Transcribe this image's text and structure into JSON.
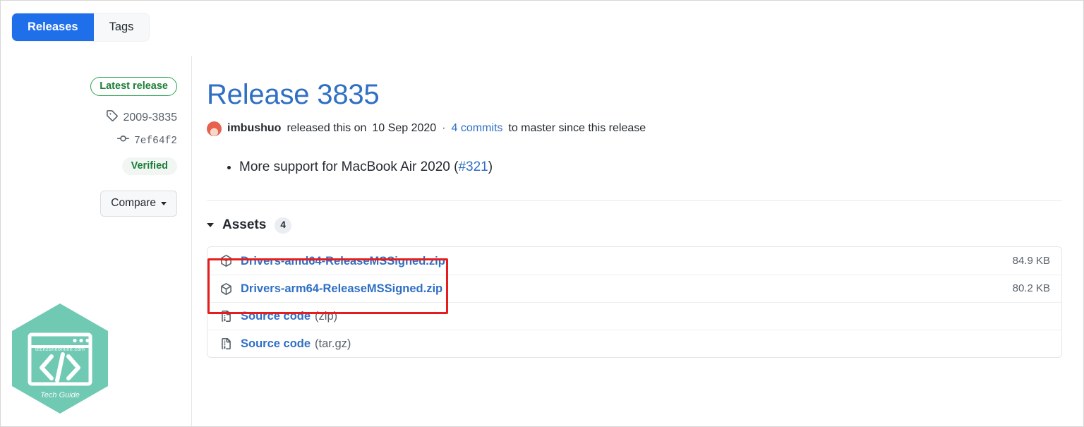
{
  "tabs": [
    {
      "label": "Releases",
      "active": true
    },
    {
      "label": "Tags",
      "active": false
    }
  ],
  "sidebar": {
    "latest_release_badge": "Latest release",
    "tag_icon": "tag-icon",
    "tag_name": "2009-3835",
    "commit_icon": "commit-icon",
    "commit_sha": "7ef64f2",
    "verified_badge": "Verified",
    "compare_button": "Compare",
    "compare_caret_icon": "chevron-down-icon"
  },
  "release": {
    "title": "Release 3835",
    "author": "imbushuo",
    "released_text": "released this on",
    "date": "10 Sep 2020",
    "separator": "·",
    "commits_link": "4 commits",
    "commits_suffix": "to master since this release",
    "avatar_icon": "avatar"
  },
  "body": {
    "bullets": [
      {
        "text": "More support for MacBook Air 2020 (",
        "link": "#321",
        "tail": ")"
      }
    ]
  },
  "assets": {
    "caret_icon": "chevron-down-icon",
    "title": "Assets",
    "count": "4",
    "rows": [
      {
        "icon": "package-icon",
        "name": "Drivers-amd64-ReleaseMSSigned.zip",
        "suffix": "",
        "size": "84.9 KB",
        "highlighted": true
      },
      {
        "icon": "package-icon",
        "name": "Drivers-arm64-ReleaseMSSigned.zip",
        "suffix": "",
        "size": "80.2 KB",
        "highlighted": true
      },
      {
        "icon": "file-zip-icon",
        "name": "Source code",
        "suffix": "(zip)",
        "size": "",
        "highlighted": false
      },
      {
        "icon": "file-zip-icon",
        "name": "Source code",
        "suffix": "(tar.gz)",
        "size": "",
        "highlighted": false
      }
    ]
  },
  "annotation": {
    "color": "#e71d1d",
    "shape": "rectangle"
  },
  "watermark": {
    "site": "techzoneonline.com",
    "caption": "Tech Guide",
    "glyph": "</>",
    "color": "#6fc9b3"
  },
  "colors": {
    "accent_blue": "#2f6fc4",
    "tab_active_blue": "#1f6feb",
    "green": "#1a7f37",
    "muted": "#57606a",
    "annotation_red": "#e71d1d"
  }
}
